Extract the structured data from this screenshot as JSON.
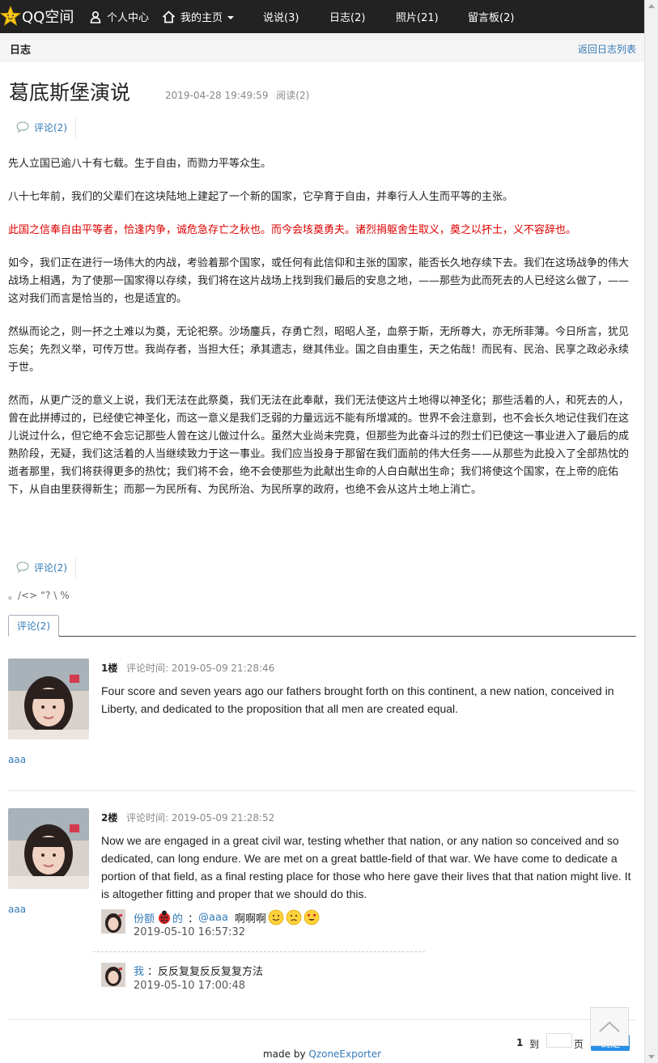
{
  "colors": {
    "nav_bg": "#222222",
    "link": "#337ab7",
    "red_text": "#e00000",
    "go_button": "#2a8ee6"
  },
  "nav": {
    "brand": "QQ空间",
    "items": [
      {
        "label": "个人中心",
        "icon": "user-icon"
      },
      {
        "label": "我的主页",
        "icon": "home-icon",
        "has_dropdown": true
      },
      {
        "label": "说说(3)"
      },
      {
        "label": "日志(2)"
      },
      {
        "label": "照片(21)"
      },
      {
        "label": "留言板(2)"
      }
    ]
  },
  "subheader": {
    "title": "日志",
    "back_link": "返回日志列表"
  },
  "post": {
    "title": "葛底斯堡演说",
    "datetime": "2019-04-28 19:49:59",
    "reads": "阅读(2)",
    "comment_count_label": "评论(2)",
    "paragraphs": [
      {
        "text": "先人立国已逾八十有七载。生于自由，而勠力平等众生。",
        "red": false
      },
      {
        "text": "八十七年前，我们的父辈们在这块陆地上建起了一个新的国家，它孕育于自由，并奉行人人生而平等的主张。",
        "red": false
      },
      {
        "text": "此国之信奉自由平等者，恰逢内争，诚危急存亡之秋也。而今会垓奠勇夫。诸烈捐躯舍生取义，奠之以抔土，义不容辞也。",
        "red": true
      },
      {
        "text": "如今，我们正在进行一场伟大的内战，考验着那个国家，或任何有此信仰和主张的国家，能否长久地存续下去。我们在这场战争的伟大战场上相遇，为了使那一国家得以存续，我们将在这片战场上找到我们最后的安息之地，——那些为此而死去的人已经这么做了，——这对我们而言是恰当的，也是适宜的。",
        "red": false
      },
      {
        "text": "然纵而论之，则一抔之土难以为奠，无论祀祭。沙场鏖兵，存勇亡烈，昭昭人圣，血祭于斯，无所尊大，亦无所菲薄。今日所言，犹见忘矣；先烈义举，可传万世。我尚存者，当担大任；承其遗志，继其伟业。国之自由重生，天之佑哉！而民有、民治、民享之政必永续于世。",
        "red": false
      },
      {
        "text": "然而，从更广泛的意义上说，我们无法在此祭奠，我们无法在此奉献，我们无法使这片土地得以神圣化；那些活着的人，和死去的人，曾在此拼搏过的，已经使它神圣化，而这一意义是我们乏弱的力量远远不能有所增减的。世界不会注意到，也不会长久地记住我们在这儿说过什么，但它绝不会忘记那些人曾在这儿做过什么。虽然大业尚未完竟，但那些为此奋斗过的烈士们已使这一事业进入了最后的成熟阶段，无疑，我们这活着的人当继续致力于这一事业。我们应当投身于那留在我们面前的伟大任务——从那些为此投入了全部热忱的逝者那里，我们将获得更多的热忱；我们将不会，绝不会使那些为此献出生命的人白白献出生命；我们将使这个国家，在上帝的庇佑下，从自由里获得新生；而那一为民所有、为民所治、为民所享的政府，也绝不会从这片土地上消亡。",
        "red": false
      }
    ],
    "tiny_text": "。/<> “? \\ %"
  },
  "comments_tab": "评论(2)",
  "comments": [
    {
      "floor": "1楼",
      "time": "评论时间: 2019-05-09 21:28:46",
      "author": "aaa",
      "text": "Four score and seven years ago our fathers brought forth on this continent, a new nation, conceived in Liberty, and dedicated to the proposition that all men are created equal."
    },
    {
      "floor": "2楼",
      "time": "评论时间: 2019-05-09 21:28:52",
      "author": "aaa",
      "text": "Now we are engaged in a great civil war, testing whether that nation, or any nation so conceived and so dedicated, can long endure. We are met on a great battle-field of that war. We have come to dedicate a portion of that field, as a final resting place for those who here gave their lives that that nation might live. It is altogether fitting and proper that we should do this.",
      "replies": [
        {
          "user_a": "份额",
          "user_b": "的",
          "sep": "：",
          "mention": "@aaa",
          "text": "啊啊啊",
          "time": "2019-05-10 16:57:32",
          "emojis": [
            "slight-smile-emoji",
            "sad-emoji",
            "heart-eyes-emoji"
          ]
        },
        {
          "user": "我",
          "text": "：反反复复反反复复方法",
          "time": "2019-05-10 17:00:48"
        }
      ]
    }
  ],
  "pager": {
    "current": "1",
    "to": "到",
    "page": "页",
    "go": "确定"
  },
  "footer": {
    "prefix": "made by ",
    "link": "QzoneExporter"
  }
}
